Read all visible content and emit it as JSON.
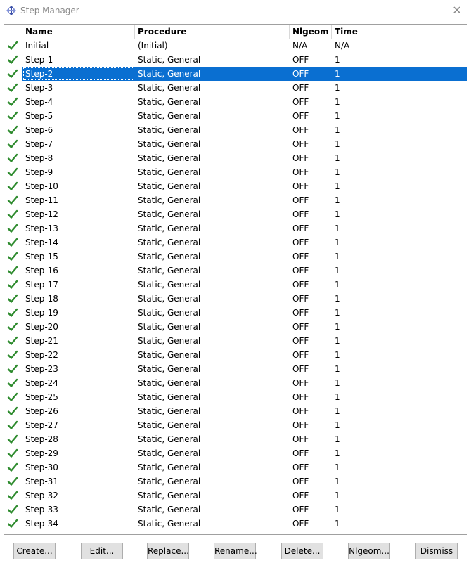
{
  "window": {
    "title": "Step Manager",
    "close_glyph": "✕"
  },
  "table": {
    "columns": [
      "Name",
      "Procedure",
      "Nlgeom",
      "Time"
    ],
    "selected_index": 2,
    "rows": [
      {
        "name": "Initial",
        "procedure": "(Initial)",
        "nlgeom": "N/A",
        "time": "N/A"
      },
      {
        "name": "Step-1",
        "procedure": "Static, General",
        "nlgeom": "OFF",
        "time": "1"
      },
      {
        "name": "Step-2",
        "procedure": "Static, General",
        "nlgeom": "OFF",
        "time": "1"
      },
      {
        "name": "Step-3",
        "procedure": "Static, General",
        "nlgeom": "OFF",
        "time": "1"
      },
      {
        "name": "Step-4",
        "procedure": "Static, General",
        "nlgeom": "OFF",
        "time": "1"
      },
      {
        "name": "Step-5",
        "procedure": "Static, General",
        "nlgeom": "OFF",
        "time": "1"
      },
      {
        "name": "Step-6",
        "procedure": "Static, General",
        "nlgeom": "OFF",
        "time": "1"
      },
      {
        "name": "Step-7",
        "procedure": "Static, General",
        "nlgeom": "OFF",
        "time": "1"
      },
      {
        "name": "Step-8",
        "procedure": "Static, General",
        "nlgeom": "OFF",
        "time": "1"
      },
      {
        "name": "Step-9",
        "procedure": "Static, General",
        "nlgeom": "OFF",
        "time": "1"
      },
      {
        "name": "Step-10",
        "procedure": "Static, General",
        "nlgeom": "OFF",
        "time": "1"
      },
      {
        "name": "Step-11",
        "procedure": "Static, General",
        "nlgeom": "OFF",
        "time": "1"
      },
      {
        "name": "Step-12",
        "procedure": "Static, General",
        "nlgeom": "OFF",
        "time": "1"
      },
      {
        "name": "Step-13",
        "procedure": "Static, General",
        "nlgeom": "OFF",
        "time": "1"
      },
      {
        "name": "Step-14",
        "procedure": "Static, General",
        "nlgeom": "OFF",
        "time": "1"
      },
      {
        "name": "Step-15",
        "procedure": "Static, General",
        "nlgeom": "OFF",
        "time": "1"
      },
      {
        "name": "Step-16",
        "procedure": "Static, General",
        "nlgeom": "OFF",
        "time": "1"
      },
      {
        "name": "Step-17",
        "procedure": "Static, General",
        "nlgeom": "OFF",
        "time": "1"
      },
      {
        "name": "Step-18",
        "procedure": "Static, General",
        "nlgeom": "OFF",
        "time": "1"
      },
      {
        "name": "Step-19",
        "procedure": "Static, General",
        "nlgeom": "OFF",
        "time": "1"
      },
      {
        "name": "Step-20",
        "procedure": "Static, General",
        "nlgeom": "OFF",
        "time": "1"
      },
      {
        "name": "Step-21",
        "procedure": "Static, General",
        "nlgeom": "OFF",
        "time": "1"
      },
      {
        "name": "Step-22",
        "procedure": "Static, General",
        "nlgeom": "OFF",
        "time": "1"
      },
      {
        "name": "Step-23",
        "procedure": "Static, General",
        "nlgeom": "OFF",
        "time": "1"
      },
      {
        "name": "Step-24",
        "procedure": "Static, General",
        "nlgeom": "OFF",
        "time": "1"
      },
      {
        "name": "Step-25",
        "procedure": "Static, General",
        "nlgeom": "OFF",
        "time": "1"
      },
      {
        "name": "Step-26",
        "procedure": "Static, General",
        "nlgeom": "OFF",
        "time": "1"
      },
      {
        "name": "Step-27",
        "procedure": "Static, General",
        "nlgeom": "OFF",
        "time": "1"
      },
      {
        "name": "Step-28",
        "procedure": "Static, General",
        "nlgeom": "OFF",
        "time": "1"
      },
      {
        "name": "Step-29",
        "procedure": "Static, General",
        "nlgeom": "OFF",
        "time": "1"
      },
      {
        "name": "Step-30",
        "procedure": "Static, General",
        "nlgeom": "OFF",
        "time": "1"
      },
      {
        "name": "Step-31",
        "procedure": "Static, General",
        "nlgeom": "OFF",
        "time": "1"
      },
      {
        "name": "Step-32",
        "procedure": "Static, General",
        "nlgeom": "OFF",
        "time": "1"
      },
      {
        "name": "Step-33",
        "procedure": "Static, General",
        "nlgeom": "OFF",
        "time": "1"
      },
      {
        "name": "Step-34",
        "procedure": "Static, General",
        "nlgeom": "OFF",
        "time": "1"
      }
    ]
  },
  "buttons": {
    "create": "Create...",
    "edit": "Edit...",
    "replace": "Replace...",
    "rename": "Rename...",
    "delete": "Delete...",
    "nlgeom": "Nlgeom...",
    "dismiss": "Dismiss"
  },
  "icons": {
    "app": "step-manager-icon",
    "row_status": "checkmark-icon",
    "close": "close-icon"
  },
  "colors": {
    "selection": "#0a6fd1",
    "check": "#2e8b2e",
    "title_text": "#8a8a8a",
    "button_face": "#e1e1e1"
  }
}
